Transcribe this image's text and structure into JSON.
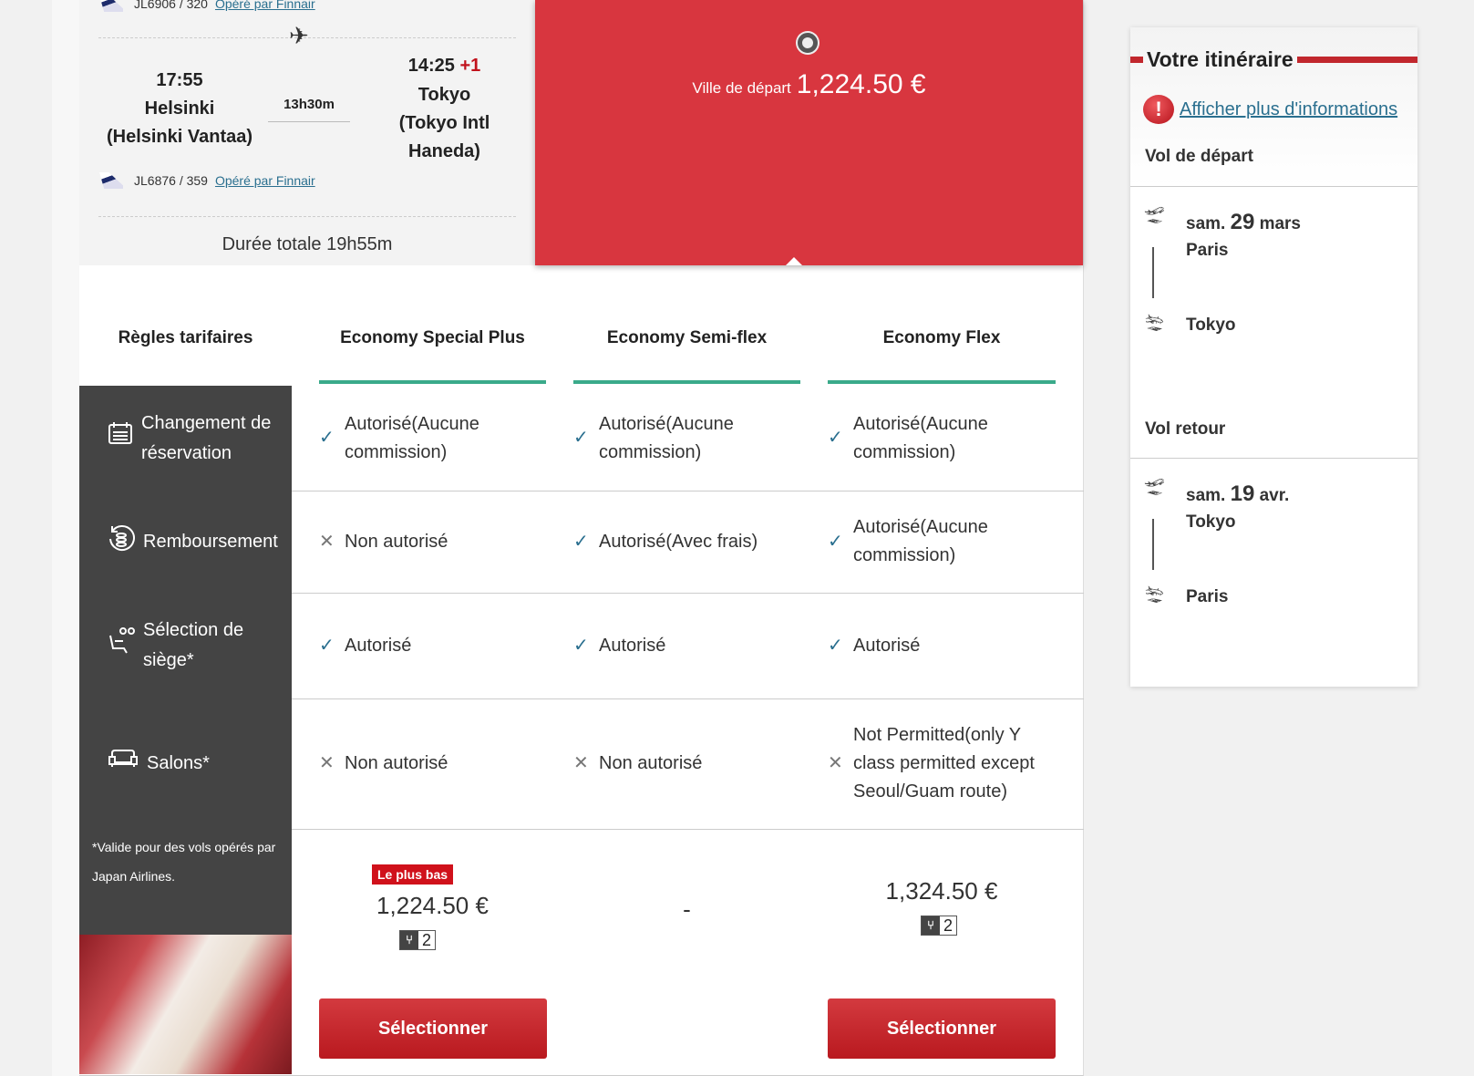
{
  "flight": {
    "top_flight": "JL6906 / 320",
    "top_operator": "Opéré par Finnair",
    "dep_time": "17:55",
    "dep_city": "Helsinki",
    "dep_airport": "(Helsinki Vantaa)",
    "duration": "13h30m",
    "arr_time": "14:25",
    "arr_offset": "+1",
    "arr_city": "Tokyo",
    "arr_airport_1": "(Tokyo Intl",
    "arr_airport_2": "Haneda)",
    "flight_no": "JL6876 / 359",
    "operator": "Opéré par Finnair",
    "total": "Durée totale 19h55m"
  },
  "selected": {
    "label": "Ville de départ",
    "price": "1,224.50 €"
  },
  "table": {
    "header": "Règles tarifaires",
    "fares": [
      "Economy Special Plus",
      "Economy Semi-flex",
      "Economy Flex"
    ],
    "rows": [
      {
        "label": "Changement de réservation",
        "icon": "calendar-icon",
        "cells": [
          {
            "s": "ok",
            "t": "Autorisé(Aucune commission)"
          },
          {
            "s": "ok",
            "t": "Autorisé(Aucune commission)"
          },
          {
            "s": "ok",
            "t": "Autorisé(Aucune commission)"
          }
        ]
      },
      {
        "label": "Remboursement",
        "icon": "refund-icon",
        "cells": [
          {
            "s": "no",
            "t": "Non autorisé"
          },
          {
            "s": "ok",
            "t": "Autorisé(Avec frais)"
          },
          {
            "s": "ok",
            "t": "Autorisé(Aucune commission)"
          }
        ]
      },
      {
        "label": "Sélection de siège*",
        "icon": "seat-selection-icon",
        "cells": [
          {
            "s": "ok",
            "t": "Autorisé"
          },
          {
            "s": "ok",
            "t": "Autorisé"
          },
          {
            "s": "ok",
            "t": "Autorisé"
          }
        ]
      },
      {
        "label": "Salons*",
        "icon": "lounge-sofa-icon",
        "cells": [
          {
            "s": "no",
            "t": "Non autorisé"
          },
          {
            "s": "no",
            "t": "Non autorisé"
          },
          {
            "s": "no",
            "t": "Not Permitted(only Y class permitted except Seoul/Guam route)"
          }
        ]
      }
    ],
    "note": "*Valide pour des vols opérés par Japan Airlines.",
    "lowest_badge": "Le plus bas",
    "prices": [
      "1,224.50 €",
      "-",
      "1,324.50 €"
    ],
    "seats_left": [
      "2",
      "",
      "2"
    ],
    "select_label": "Sélectionner"
  },
  "sidebar": {
    "title": "Votre itinéraire",
    "more_info": "Afficher plus d'informations",
    "outbound": {
      "heading": "Vol de départ",
      "dow": "sam.",
      "day": "29",
      "month": "mars",
      "from": "Paris",
      "to": "Tokyo"
    },
    "return": {
      "heading": "Vol retour",
      "dow": "sam.",
      "day": "19",
      "month": "avr.",
      "from": "Tokyo",
      "to": "Paris"
    }
  },
  "colors": {
    "accent_red": "#d8363f",
    "fare_underline": "#3aaa8a",
    "row_header": "#444444",
    "check": "#2a6f8f"
  }
}
